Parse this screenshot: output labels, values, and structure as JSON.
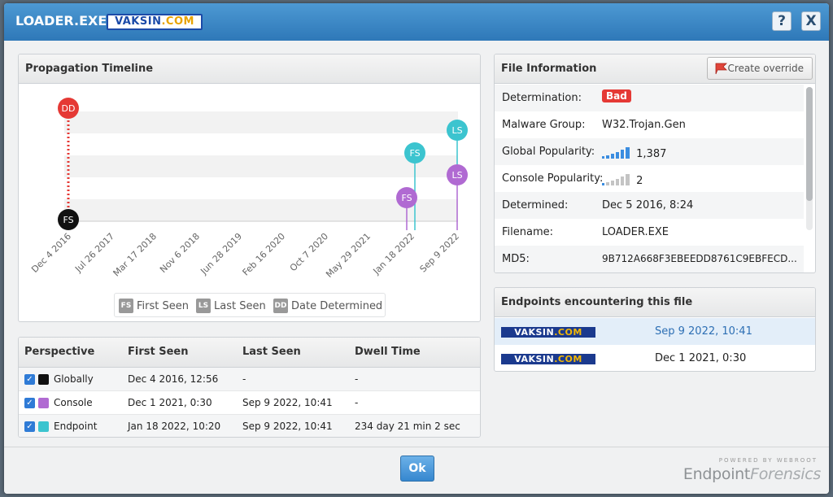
{
  "window": {
    "title": "LOADER.EXE",
    "brand_badge_prefix": "VAKSIN",
    "brand_badge_suffix": ".COM",
    "help_label": "?",
    "close_label": "X"
  },
  "timeline": {
    "title": "Propagation Timeline",
    "x_ticks": [
      "Dec 4 2016",
      "Jul 26 2017",
      "Mar 17 2018",
      "Nov 6 2018",
      "Jun 28 2019",
      "Feb 16 2020",
      "Oct 7 2020",
      "May 29 2021",
      "Jan 18 2022",
      "Sep 9 2022"
    ],
    "markers": [
      {
        "label": "DD",
        "color": "#e53935"
      },
      {
        "label": "FS",
        "color": "#111111"
      },
      {
        "label": "FS",
        "color": "#b06ad2"
      },
      {
        "label": "FS",
        "color": "#3cc4cf"
      },
      {
        "label": "LS",
        "color": "#3cc4cf"
      },
      {
        "label": "LS",
        "color": "#b06ad2"
      }
    ],
    "legend": [
      {
        "code": "FS",
        "label": "First Seen"
      },
      {
        "code": "LS",
        "label": "Last Seen"
      },
      {
        "code": "DD",
        "label": "Date Determined"
      }
    ]
  },
  "perspective": {
    "headers": [
      "Perspective",
      "First Seen",
      "Last Seen",
      "Dwell Time"
    ],
    "rows": [
      {
        "name": "Globally",
        "color": "#111111",
        "first_seen": "Dec 4 2016, 12:56",
        "last_seen": "-",
        "dwell": "-"
      },
      {
        "name": "Console",
        "color": "#b06ad2",
        "first_seen": "Dec 1 2021, 0:30",
        "last_seen": "Sep 9 2022, 10:41",
        "dwell": "-"
      },
      {
        "name": "Endpoint",
        "color": "#3cc4cf",
        "first_seen": "Jan 18 2022, 10:20",
        "last_seen": "Sep 9 2022, 10:41",
        "dwell": "234 day 21 min 2 sec"
      }
    ]
  },
  "file_info": {
    "title": "File Information",
    "override_label": "Create override",
    "determination_label": "Determination:",
    "determination_value": "Bad",
    "malware_group_label": "Malware Group:",
    "malware_group_value": "W32.Trojan.Gen",
    "global_pop_label": "Global Popularity:",
    "global_pop_value": "1,387",
    "console_pop_label": "Console Popularity:",
    "console_pop_value": "2",
    "determined_label": "Determined:",
    "determined_value": "Dec 5 2016, 8:24",
    "filename_label": "Filename:",
    "filename_value": "LOADER.EXE",
    "md5_label": "MD5:",
    "md5_value": "9B712A668F3EBEEDD8761C9EBFECD..."
  },
  "endpoints": {
    "title": "Endpoints encountering this file",
    "rows": [
      {
        "logo_prefix": "VAKSIN",
        "logo_suffix": ".COM",
        "date": "Sep 9 2022, 10:41",
        "selected": true
      },
      {
        "logo_prefix": "VAKSIN",
        "logo_suffix": ".COM",
        "date": "Dec 1 2021, 0:30",
        "selected": false
      }
    ]
  },
  "footer": {
    "ok_label": "Ok",
    "powered_by": "POWERED BY WEBROOT",
    "product_part1": "Endpoint",
    "product_part2": "Forensics"
  },
  "colors": {
    "accent": "#2e78b8",
    "bad": "#e53935",
    "popularity_blue": "#3b8de0",
    "popularity_grey": "#c4c4c4"
  }
}
